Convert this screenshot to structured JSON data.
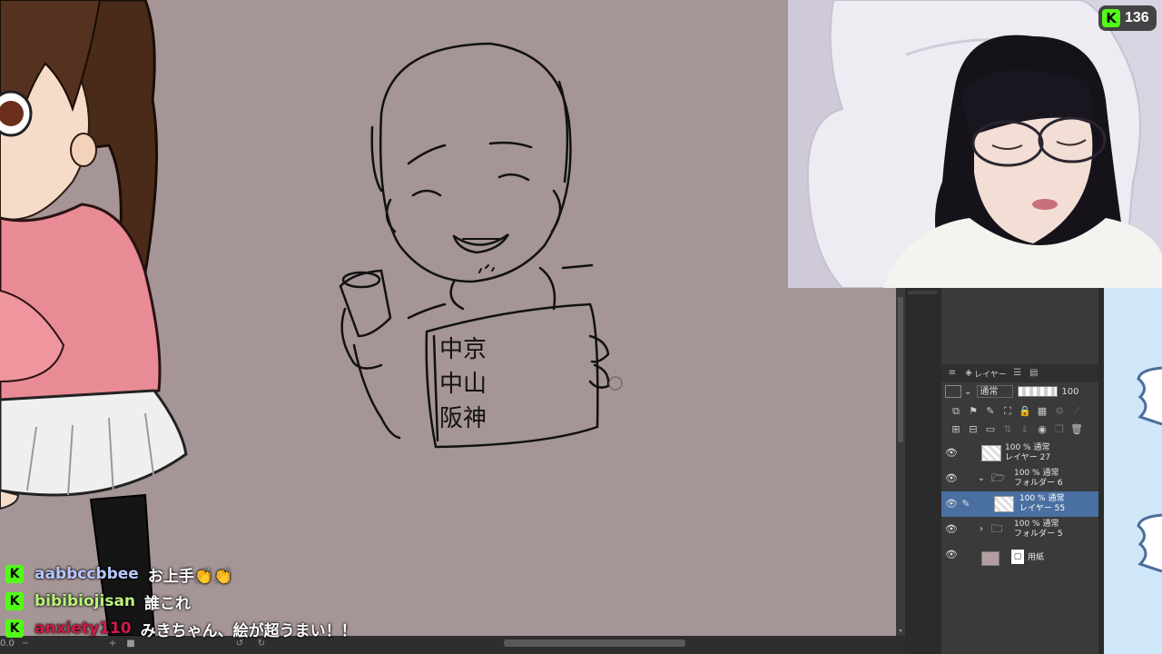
{
  "stream": {
    "viewer_count": "136",
    "kick_icon": "kick-logo-icon"
  },
  "chat": [
    {
      "user": "aabbccbbee",
      "color": "#b8c8ff",
      "message": "お上手👏👏"
    },
    {
      "user": "bibibiojisan",
      "color": "#b9f27a",
      "message": "誰これ"
    },
    {
      "user": "anxiety110",
      "color": "#d01a4a",
      "message": "みきちゃん、絵が超うまい！！"
    }
  ],
  "canvas": {
    "sketch_text": [
      "中京",
      "中山",
      "阪神"
    ],
    "zoom_label": "0.0"
  },
  "layer_panel": {
    "tabs": [
      {
        "icon": "layers-icon",
        "label": "レイヤー"
      },
      {
        "icon": "history-icon",
        "label": ""
      },
      {
        "icon": "stack-icon",
        "label": ""
      }
    ],
    "blend_mode": "通常",
    "opacity": "100",
    "layers": [
      {
        "percent_mode": "100 % 通常",
        "name": "レイヤー 27",
        "type": "raster",
        "selected": false
      },
      {
        "percent_mode": "100 % 通常",
        "name": "フォルダー 6",
        "type": "folder-open",
        "selected": false
      },
      {
        "percent_mode": "100 % 通常",
        "name": "レイヤー 55",
        "type": "raster",
        "selected": true
      },
      {
        "percent_mode": "100 % 通常",
        "name": "フォルダー 5",
        "type": "folder-closed",
        "selected": false
      },
      {
        "percent_mode": "",
        "name": "用紙",
        "type": "paper",
        "selected": false
      }
    ]
  },
  "colors": {
    "canvas_bg": "#a69596",
    "kick_green": "#53fc18",
    "panel_bg": "#3a3a3a",
    "selection_blue": "#4a6fa1"
  }
}
